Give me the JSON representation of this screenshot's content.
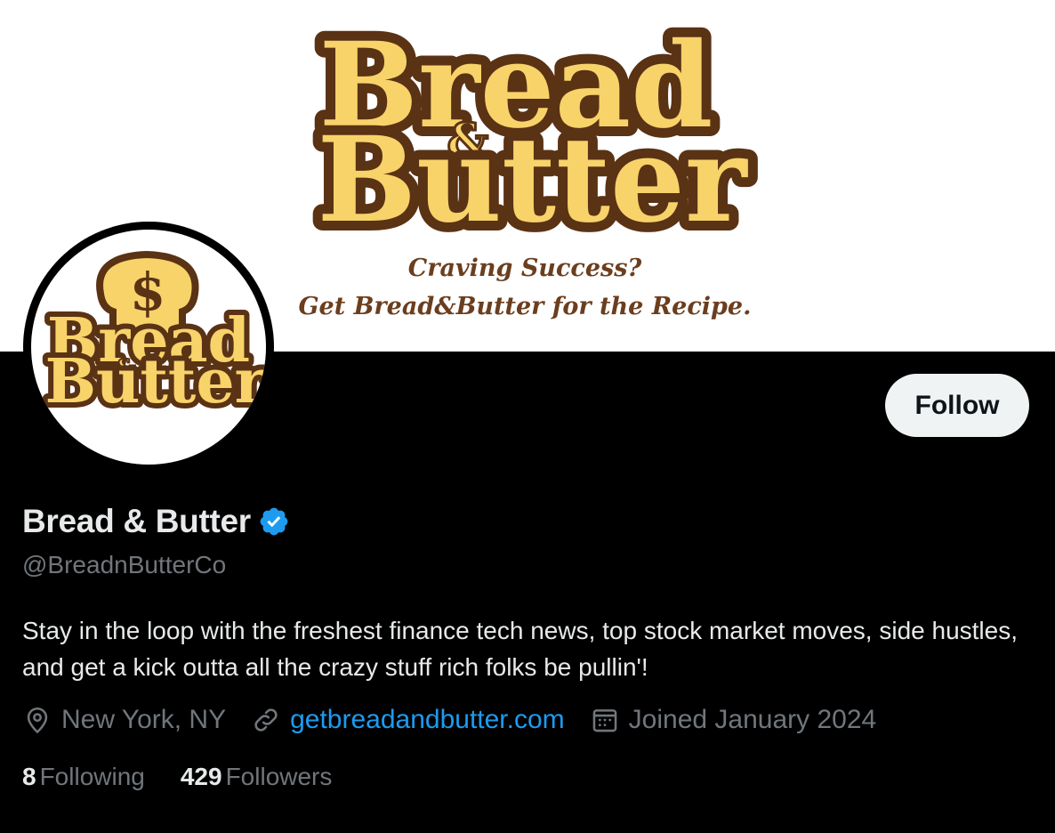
{
  "banner": {
    "logo_word_1": "Bread",
    "logo_amp": "&",
    "logo_word_2": "Butter",
    "tagline_1": "Craving Success?",
    "tagline_2": "Get Bread&Butter for the Recipe.",
    "colors": {
      "yellow": "#f7d36a",
      "brown": "#5a3214",
      "tagline": "#6b3e1e"
    }
  },
  "avatar": {
    "logo_symbol": "$",
    "logo_word_1": "Bread",
    "logo_amp": "&",
    "logo_word_2": "Butter"
  },
  "profile": {
    "follow_label": "Follow",
    "display_name": "Bread & Butter",
    "verified_icon": "verified-badge-icon",
    "handle": "@BreadnButterCo",
    "bio": "Stay in the loop with the freshest finance tech news, top stock market moves, side hustles, and get a kick outta all the crazy stuff rich folks be pullin'!",
    "location": "New York, NY",
    "website": "getbreadandbutter.com",
    "joined": "Joined January 2024",
    "following_count": "8",
    "following_label": "Following",
    "followers_count": "429",
    "followers_label": "Followers"
  },
  "colors": {
    "accent": "#1d9bf0",
    "muted": "#71767b",
    "text": "#e7e9ea",
    "background": "#000000"
  }
}
